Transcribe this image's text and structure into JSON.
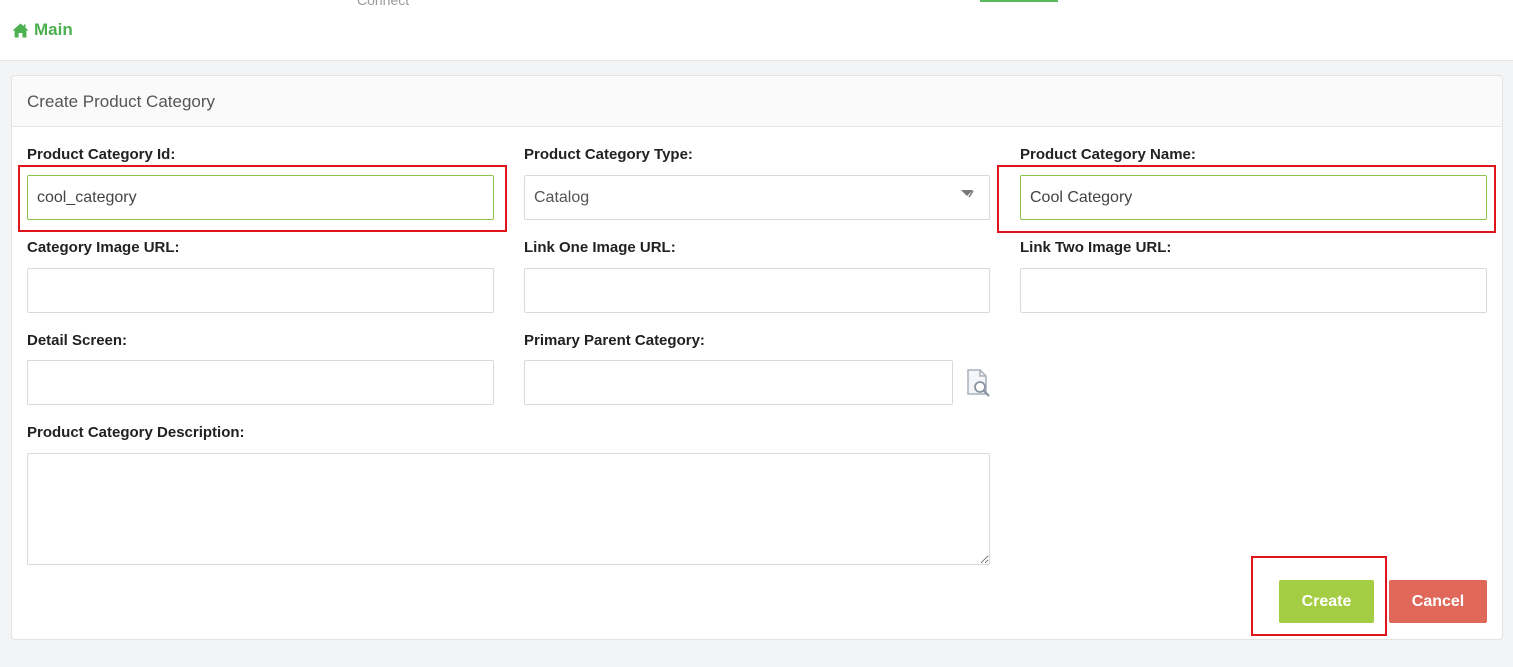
{
  "top_bar": {
    "cut_text": "Connect"
  },
  "breadcrumb": {
    "home_label": "Main"
  },
  "panel": {
    "title": "Create Product Category"
  },
  "form": {
    "category_id": {
      "label": "Product Category Id:",
      "value": "cool_category"
    },
    "category_type": {
      "label": "Product Category Type:",
      "value": "Catalog"
    },
    "category_name": {
      "label": "Product Category Name:",
      "value": "Cool Category"
    },
    "category_image_url": {
      "label": "Category Image URL:",
      "value": ""
    },
    "link_one_image_url": {
      "label": "Link One Image URL:",
      "value": ""
    },
    "link_two_image_url": {
      "label": "Link Two Image URL:",
      "value": ""
    },
    "detail_screen": {
      "label": "Detail Screen:",
      "value": ""
    },
    "primary_parent_category": {
      "label": "Primary Parent Category:",
      "value": ""
    },
    "description": {
      "label": "Product Category Description:",
      "value": ""
    }
  },
  "buttons": {
    "create": "Create",
    "cancel": "Cancel"
  },
  "colors": {
    "accent_green": "#4caf50",
    "create_button": "#a4cd44",
    "cancel_button": "#e0685a",
    "highlight_red": "#e0141b"
  }
}
